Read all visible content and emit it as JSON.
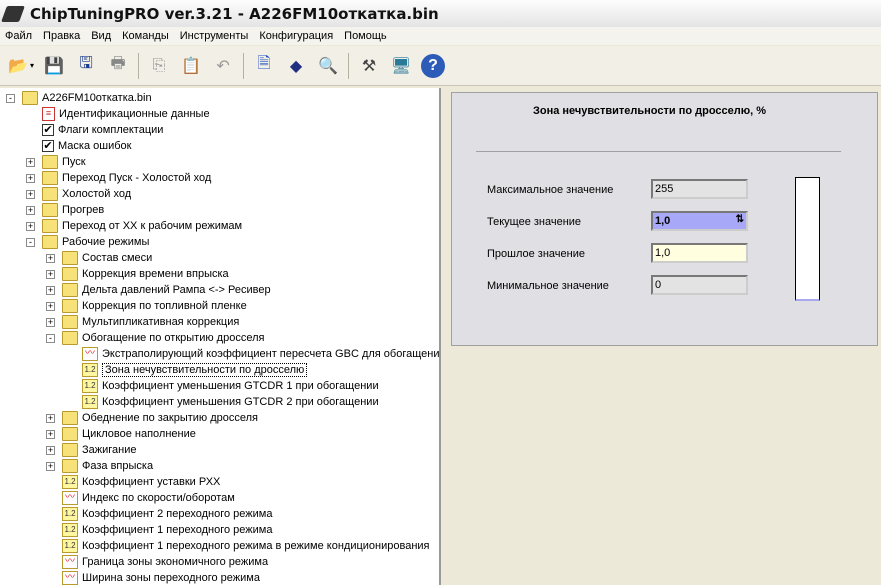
{
  "window": {
    "title": "ChipTuningPRO ver.3.21 - A226FM10откатка.bin"
  },
  "menu": [
    "Файл",
    "Правка",
    "Вид",
    "Команды",
    "Инструменты",
    "Конфигурация",
    "Помощь"
  ],
  "toolbar": [
    "open-icon",
    "save-icon",
    "save-as-icon",
    "print-icon",
    "copy-icon",
    "paste-icon",
    "undo-icon",
    "report-icon",
    "info-icon",
    "search-icon",
    "tools-icon",
    "network-icon",
    "help-icon"
  ],
  "tree": [
    {
      "label": "A226FM10откатка.bin",
      "level": 0,
      "icon": "folder",
      "exp": "-"
    },
    {
      "label": "Идентификационные данные",
      "level": 1,
      "icon": "doc"
    },
    {
      "label": "Флаги комплектации",
      "level": 1,
      "icon": "check"
    },
    {
      "label": "Маска ошибок",
      "level": 1,
      "icon": "check"
    },
    {
      "label": "Пуск",
      "level": 1,
      "icon": "folder",
      "exp": "+"
    },
    {
      "label": "Переход Пуск - Холостой ход",
      "level": 1,
      "icon": "folder",
      "exp": "+"
    },
    {
      "label": "Холостой ход",
      "level": 1,
      "icon": "folder",
      "exp": "+"
    },
    {
      "label": "Прогрев",
      "level": 1,
      "icon": "folder",
      "exp": "+"
    },
    {
      "label": "Переход от ХХ к рабочим режимам",
      "level": 1,
      "icon": "folder",
      "exp": "+"
    },
    {
      "label": "Рабочие режимы",
      "level": 1,
      "icon": "folder",
      "exp": "-"
    },
    {
      "label": "Состав смеси",
      "level": 2,
      "icon": "folder",
      "exp": "+"
    },
    {
      "label": "Коррекция времени впрыска",
      "level": 2,
      "icon": "folder",
      "exp": "+"
    },
    {
      "label": "Дельта давлений Рампа <-> Ресивер",
      "level": 2,
      "icon": "folder",
      "exp": "+"
    },
    {
      "label": "Коррекция по топливной пленке",
      "level": 2,
      "icon": "folder",
      "exp": "+"
    },
    {
      "label": "Мультипликативная коррекция",
      "level": 2,
      "icon": "folder",
      "exp": "+"
    },
    {
      "label": "Обогащение по открытию дросселя",
      "level": 2,
      "icon": "folder",
      "exp": "-"
    },
    {
      "label": "Экстраполирующий коэффициент пересчета GBC для обогащения",
      "level": 3,
      "icon": "chart"
    },
    {
      "label": "Зона нечувствительности по дросселю",
      "level": 3,
      "icon": "num",
      "selected": true
    },
    {
      "label": "Коэффициент уменьшения GTCDR 1 при обогащении",
      "level": 3,
      "icon": "num"
    },
    {
      "label": "Коэффициент уменьшения GTCDR 2 при обогащении",
      "level": 3,
      "icon": "num"
    },
    {
      "label": "Обеднение по закрытию дросселя",
      "level": 2,
      "icon": "folder",
      "exp": "+"
    },
    {
      "label": "Цикловое наполнение",
      "level": 2,
      "icon": "folder",
      "exp": "+"
    },
    {
      "label": "Зажигание",
      "level": 2,
      "icon": "folder",
      "exp": "+"
    },
    {
      "label": "Фаза впрыска",
      "level": 2,
      "icon": "folder",
      "exp": "+"
    },
    {
      "label": "Коэффициент уставки РХХ",
      "level": 2,
      "icon": "num"
    },
    {
      "label": "Индекс по скорости/оборотам",
      "level": 2,
      "icon": "chart"
    },
    {
      "label": "Коэффициент 2 переходного режима",
      "level": 2,
      "icon": "num"
    },
    {
      "label": "Коэффициент 1 переходного режима",
      "level": 2,
      "icon": "num"
    },
    {
      "label": "Коэффициент 1 переходного режима в режиме кондиционирования",
      "level": 2,
      "icon": "num"
    },
    {
      "label": "Граница зоны экономичного режима",
      "level": 2,
      "icon": "chart"
    },
    {
      "label": "Ширина зоны переходного режима",
      "level": 2,
      "icon": "chart"
    }
  ],
  "panel": {
    "title": "Зона нечувствительности по дросселю, %",
    "max_label": "Максимальное значение",
    "max_value": "255",
    "cur_label": "Текущее значение",
    "cur_value": "1,0",
    "prev_label": "Прошлое значение",
    "prev_value": "1,0",
    "min_label": "Минимальное значение",
    "min_value": "0",
    "level_fraction": 0.004
  }
}
